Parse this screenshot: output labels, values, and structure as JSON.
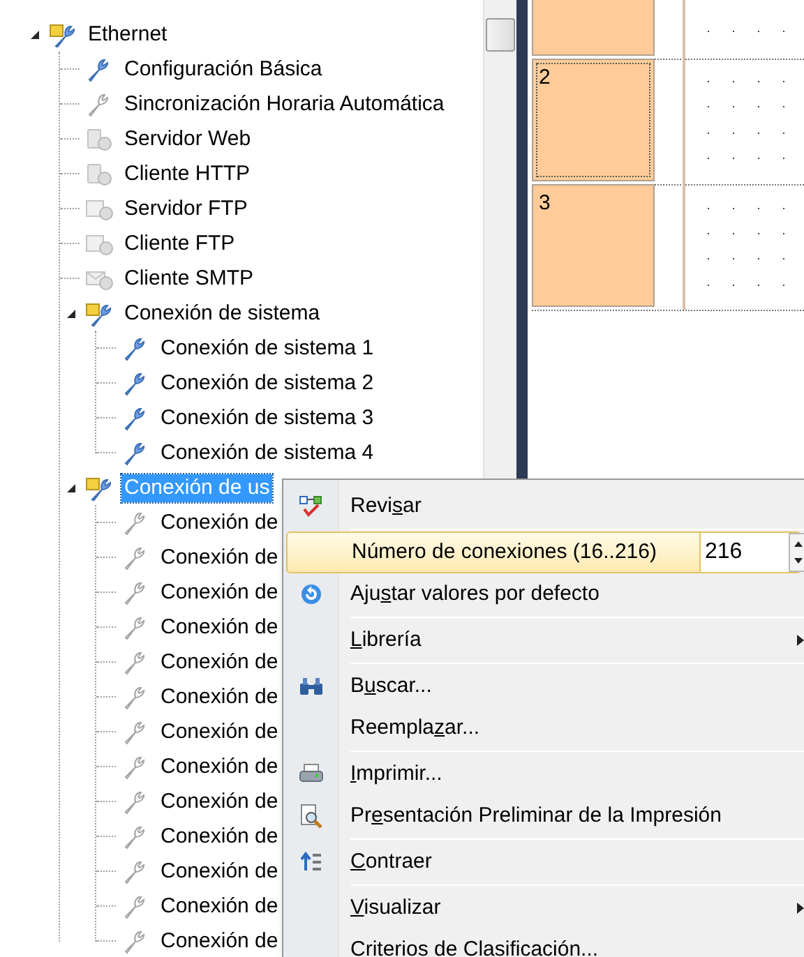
{
  "tree": {
    "items": [
      {
        "label": "Ethernet",
        "kind": "group",
        "expanded": true,
        "selected": false,
        "children": [
          {
            "label": "Configuración Básica",
            "kind": "setting",
            "enabled": true,
            "selected": false
          },
          {
            "label": "Sincronización Horaria Automática",
            "kind": "setting",
            "enabled": false,
            "selected": false
          },
          {
            "label": "Servidor Web",
            "kind": "server",
            "selected": false
          },
          {
            "label": "Cliente HTTP",
            "kind": "server",
            "selected": false
          },
          {
            "label": "Servidor FTP",
            "kind": "ftp",
            "selected": false
          },
          {
            "label": "Cliente FTP",
            "kind": "ftp",
            "selected": false
          },
          {
            "label": "Cliente SMTP",
            "kind": "mail",
            "selected": false
          },
          {
            "label": "Conexión de sistema",
            "kind": "group",
            "expanded": true,
            "selected": false,
            "children": [
              {
                "label": "Conexión de sistema 1",
                "kind": "setting",
                "enabled": true,
                "selected": false
              },
              {
                "label": "Conexión de sistema 2",
                "kind": "setting",
                "enabled": true,
                "selected": false
              },
              {
                "label": "Conexión de sistema 3",
                "kind": "setting",
                "enabled": true,
                "selected": false
              },
              {
                "label": "Conexión de sistema 4",
                "kind": "setting",
                "enabled": true,
                "selected": false
              }
            ]
          },
          {
            "label": "Conexión de us",
            "kind": "group",
            "expanded": true,
            "selected": true,
            "children": [
              {
                "label": "Conexión de",
                "kind": "setting",
                "enabled": false,
                "selected": false
              },
              {
                "label": "Conexión de",
                "kind": "setting",
                "enabled": false,
                "selected": false
              },
              {
                "label": "Conexión de",
                "kind": "setting",
                "enabled": false,
                "selected": false
              },
              {
                "label": "Conexión de",
                "kind": "setting",
                "enabled": false,
                "selected": false
              },
              {
                "label": "Conexión de",
                "kind": "setting",
                "enabled": false,
                "selected": false
              },
              {
                "label": "Conexión de",
                "kind": "setting",
                "enabled": false,
                "selected": false
              },
              {
                "label": "Conexión de",
                "kind": "setting",
                "enabled": false,
                "selected": false
              },
              {
                "label": "Conexión de",
                "kind": "setting",
                "enabled": false,
                "selected": false
              },
              {
                "label": "Conexión de",
                "kind": "setting",
                "enabled": false,
                "selected": false
              },
              {
                "label": "Conexión de",
                "kind": "setting",
                "enabled": false,
                "selected": false
              },
              {
                "label": "Conexión de",
                "kind": "setting",
                "enabled": false,
                "selected": false
              },
              {
                "label": "Conexión de",
                "kind": "setting",
                "enabled": false,
                "selected": false
              },
              {
                "label": "Conexión de",
                "kind": "setting",
                "enabled": false,
                "selected": false
              }
            ]
          }
        ]
      }
    ]
  },
  "ladder": {
    "rungs": [
      {
        "focused": false
      },
      {
        "label": "2",
        "focused": true
      },
      {
        "label": "3",
        "focused": false
      }
    ]
  },
  "context_menu": {
    "items": [
      {
        "kind": "command",
        "before": "Revi",
        "key": "s",
        "after": "ar",
        "selected": false
      },
      {
        "kind": "separator"
      },
      {
        "kind": "number",
        "label": "Número de conexiones (16..216)",
        "value": "216",
        "selected": true
      },
      {
        "kind": "command",
        "before": "Aju",
        "key": "s",
        "after": "tar valores por defecto",
        "selected": false
      },
      {
        "kind": "separator"
      },
      {
        "kind": "submenu",
        "key": "L",
        "after": "ibrería",
        "selected": false
      },
      {
        "kind": "separator"
      },
      {
        "kind": "command",
        "before": "B",
        "key": "u",
        "after": "scar...",
        "selected": false
      },
      {
        "kind": "command",
        "before": "Reempla",
        "key": "z",
        "after": "ar...",
        "selected": false
      },
      {
        "kind": "separator"
      },
      {
        "kind": "command",
        "key": "I",
        "after": "mprimir...",
        "selected": false
      },
      {
        "kind": "command",
        "before": "Pr",
        "key": "e",
        "after": "sentación Preliminar de la Impresión",
        "selected": false
      },
      {
        "kind": "separator"
      },
      {
        "kind": "command",
        "key": "C",
        "after": "ontraer",
        "selected": false
      },
      {
        "kind": "separator"
      },
      {
        "kind": "submenu",
        "key": "V",
        "after": "isualizar",
        "selected": false
      },
      {
        "kind": "command",
        "before": "Criterios de Clasificación...",
        "selected": false
      }
    ]
  }
}
